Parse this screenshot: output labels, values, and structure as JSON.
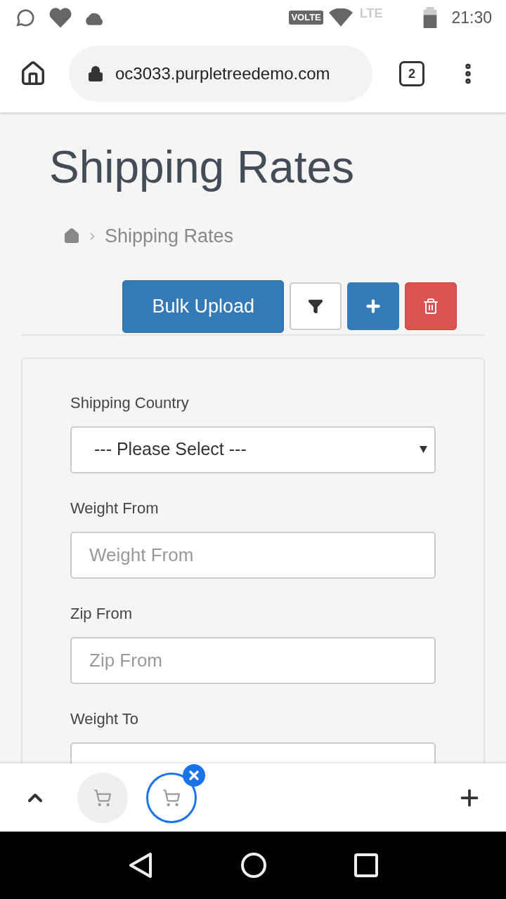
{
  "status_bar": {
    "network_badge": "VOLTE",
    "network_type": "LTE",
    "time": "21:30"
  },
  "browser": {
    "url": "oc3033.purpletreedemo.com",
    "tab_count": "2"
  },
  "page": {
    "title": "Shipping Rates",
    "breadcrumb": [
      "Shipping Rates"
    ],
    "actions": [
      {
        "kind": "text",
        "label": "Bulk Upload"
      },
      {
        "kind": "filter"
      },
      {
        "kind": "add"
      },
      {
        "kind": "delete"
      }
    ],
    "filter_fields": [
      {
        "kind": "select",
        "label": "Shipping Country",
        "value": "--- Please Select ---"
      },
      {
        "kind": "input",
        "label": "Weight From",
        "placeholder": "Weight From"
      },
      {
        "kind": "input",
        "label": "Zip From",
        "placeholder": "Zip From"
      },
      {
        "kind": "input",
        "label": "Weight To"
      }
    ]
  },
  "tab_strip": {
    "tabs": [
      {
        "selected": false
      },
      {
        "selected": true
      }
    ]
  }
}
